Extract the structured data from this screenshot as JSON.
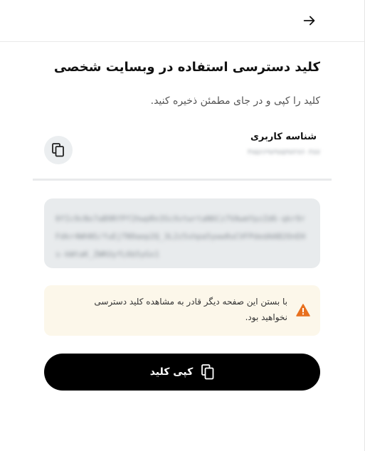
{
  "header": {
    "back_icon": "arrow-right-icon"
  },
  "title": "کلید دسترسی استفاده در وبسایت شخصی",
  "subtitle": "کلید را کپی و در جای مطمئن ذخیره کنید.",
  "user": {
    "label": "شناسه کاربری",
    "value": "۴۷۵۶۶۹۷۹۷۵۹۷۲۷۶۰۳۸۷",
    "copy_icon": "copy-icon"
  },
  "key": {
    "value": "0fIc9cNx7aB9RfPf2hwpRn3ScXvtwrtaN6Cz7VAwmYpzZd6-qkr9rFdkr4WhNS/fuEjTN9aep2Q_3L2z5shpa5yww0uCVFPdedAAB2OnEHs-kWtaK_ZWKUyfL6b5yGx1"
  },
  "warning": {
    "icon": "warning-triangle-icon",
    "text": "با بستن این صفحه دیگر قادر به مشاهده کلید دسترسی نخواهید بود.",
    "color": "#e8701e"
  },
  "primary_button": {
    "label": "کپی کلید",
    "icon": "copy-icon"
  }
}
